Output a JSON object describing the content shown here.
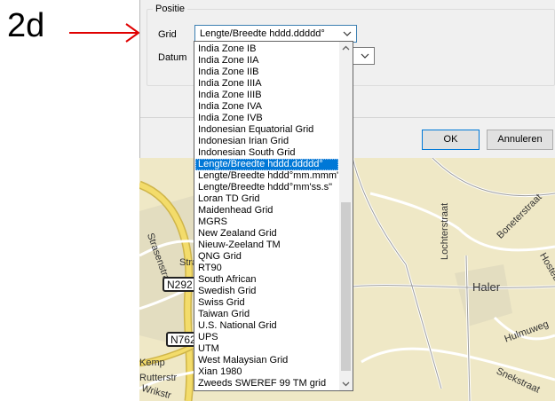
{
  "annotation": {
    "label": "2d"
  },
  "dialog": {
    "group_title": "Positie",
    "grid": {
      "label": "Grid",
      "value": "Lengte/Breedte hddd.ddddd°"
    },
    "datum": {
      "label": "Datum"
    },
    "ok_label": "OK",
    "cancel_label": "Annuleren"
  },
  "dropdown": {
    "selected": "Lengte/Breedte hddd.ddddd°",
    "items": [
      "India Zone IB",
      "India Zone IIA",
      "India Zone IIB",
      "India Zone IIIA",
      "India Zone IIIB",
      "India Zone IVA",
      "India Zone IVB",
      "Indonesian Equatorial Grid",
      "Indonesian Irian Grid",
      "Indonesian South Grid",
      "Lengte/Breedte hddd.ddddd°",
      "Lengte/Breedte hddd°mm.mmm'",
      "Lengte/Breedte hddd°mm'ss.s\"",
      "Loran TD Grid",
      "Maidenhead Grid",
      "MGRS",
      "New Zealand Grid",
      "Nieuw-Zeeland TM",
      "QNG Grid",
      "RT90",
      "South African",
      "Swedish Grid",
      "Swiss Grid",
      "Taiwan Grid",
      "U.S. National Grid",
      "UPS",
      "UTM",
      "West Malaysian Grid",
      "Xian 1980",
      "Zweeds SWEREF 99 TM grid"
    ]
  },
  "map": {
    "labels": [
      "Haler",
      "Lochterstraat",
      "Boneterstraat",
      "Hostebaan",
      "Hulmuweg",
      "Snekstraat",
      "Rutterstr",
      "Wrikstr",
      "Strasenstraat",
      "Kemp",
      "Stra"
    ],
    "shields": [
      "N292",
      "N762"
    ]
  },
  "colors": {
    "accent": "#0078d7",
    "annotation_arrow": "#e00000",
    "map_background": "#efe8c6",
    "road_major": "#f3dc6b"
  }
}
